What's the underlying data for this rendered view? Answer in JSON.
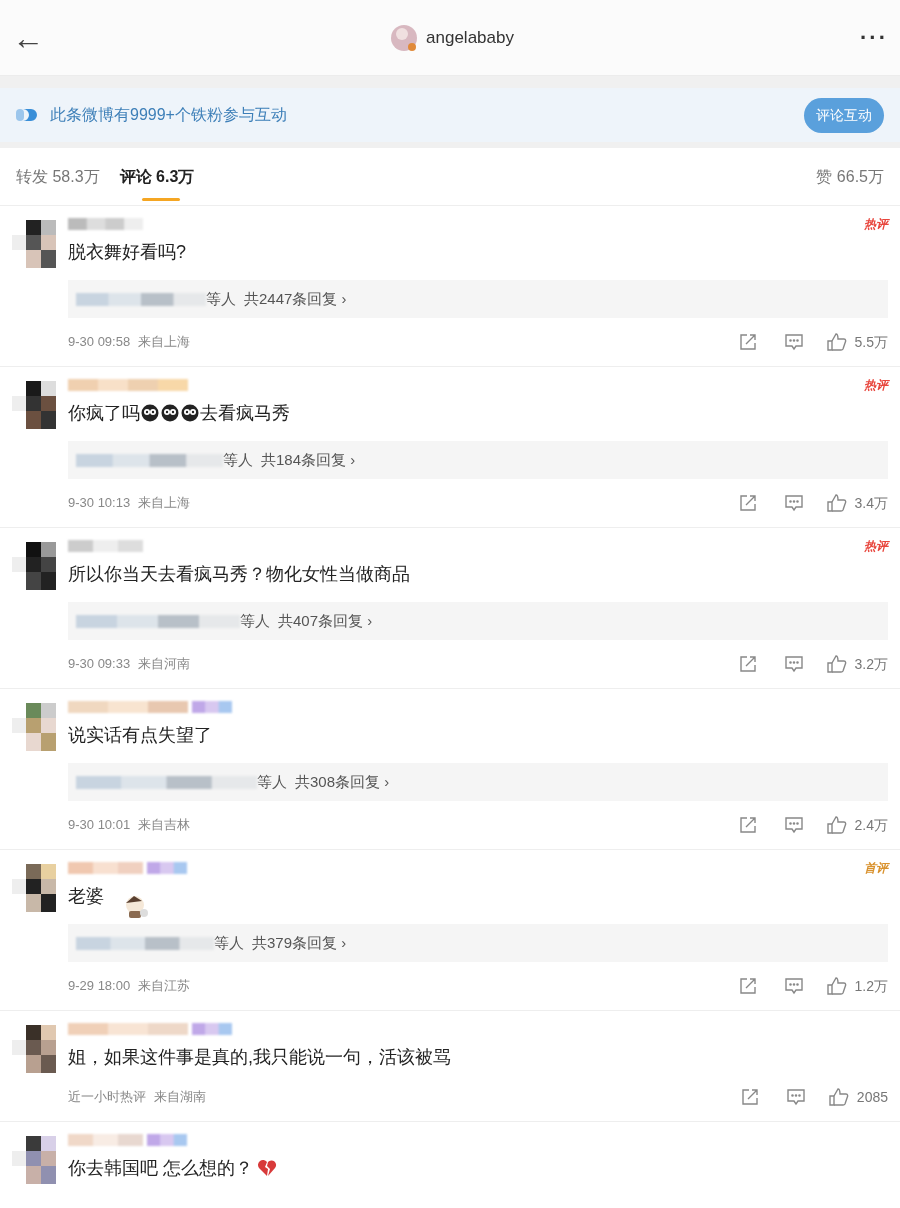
{
  "header": {
    "back": "←",
    "username": "angelababy",
    "more": "···"
  },
  "banner": {
    "text": "此条微博有9999+个铁粉参与互动",
    "button": "评论互动"
  },
  "tabs": [
    {
      "label": "转发",
      "count": "58.3万",
      "selected": false
    },
    {
      "label": "评论",
      "count": "6.3万",
      "selected": true
    }
  ],
  "likes_tab": {
    "label": "赞",
    "count": "66.5万"
  },
  "comments": [
    {
      "badge": {
        "kind": "hot",
        "text": "热评"
      },
      "content": [
        {
          "kind": "text",
          "text": "脱衣舞好看吗?"
        }
      ],
      "replies": {
        "suffix": "等人",
        "count": "共2447条回复 ›"
      },
      "time": "9-30 09:58",
      "location": "来自上海",
      "likes": "5.5万"
    },
    {
      "badge": {
        "kind": "hot",
        "text": "热评"
      },
      "content": [
        {
          "kind": "text",
          "text": "你疯了吗"
        },
        {
          "kind": "emoji"
        },
        {
          "kind": "emoji"
        },
        {
          "kind": "emoji"
        },
        {
          "kind": "text",
          "text": "去看疯马秀"
        }
      ],
      "replies": {
        "suffix": "等人",
        "count": "共184条回复 ›"
      },
      "time": "9-30 10:13",
      "location": "来自上海",
      "likes": "3.4万"
    },
    {
      "badge": {
        "kind": "hot",
        "text": "热评"
      },
      "content": [
        {
          "kind": "text",
          "text": "所以你当天去看疯马秀？物化女性当做商品"
        }
      ],
      "replies": {
        "suffix": "等人",
        "count": "共407条回复 ›"
      },
      "time": "9-30 09:33",
      "location": "来自河南",
      "likes": "3.2万"
    },
    {
      "content": [
        {
          "kind": "text",
          "text": "说实话有点失望了"
        }
      ],
      "replies": {
        "suffix": "等人",
        "count": "共308条回复 ›"
      },
      "time": "9-30 10:01",
      "location": "来自吉林",
      "likes": "2.4万"
    },
    {
      "badge": {
        "kind": "first",
        "text": "首评"
      },
      "content": [
        {
          "kind": "text",
          "text": "老婆"
        },
        {
          "kind": "sticker"
        }
      ],
      "replies": {
        "suffix": "等人",
        "count": "共379条回复 ›"
      },
      "time": "9-29 18:00",
      "location": "来自江苏",
      "likes": "1.2万"
    },
    {
      "content": [
        {
          "kind": "text",
          "text": "姐，如果这件事是真的,我只能说一句，活该被骂"
        }
      ],
      "time": "近一小时热评",
      "location": "来自湖南",
      "likes": "2085"
    },
    {
      "content": [
        {
          "kind": "text",
          "text": "你去韩国吧 怎么想的？"
        },
        {
          "kind": "broken-heart"
        }
      ]
    }
  ]
}
